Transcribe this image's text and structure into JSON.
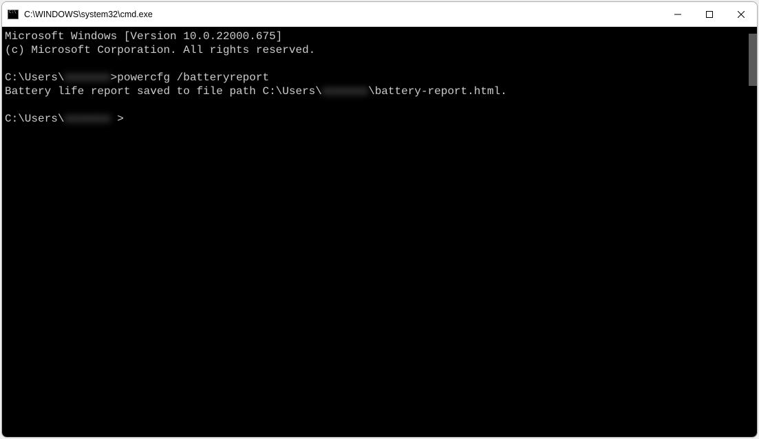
{
  "window": {
    "title": "C:\\WINDOWS\\system32\\cmd.exe"
  },
  "terminal": {
    "header_line1": "Microsoft Windows [Version 10.0.22000.675]",
    "header_line2": "(c) Microsoft Corporation. All rights reserved.",
    "prompt1_prefix": "C:\\Users\\",
    "prompt1_user_redacted": "xxxxxxx",
    "prompt1_sep": ">",
    "prompt1_command": "powercfg /batteryreport",
    "output_prefix": "Battery life report saved to file path C:\\Users\\",
    "output_user_redacted": "xxxxxxx",
    "output_suffix": "\\battery-report.html.",
    "prompt2_prefix": "C:\\Users\\",
    "prompt2_user_redacted": "xxxxxxx",
    "prompt2_sep": ">"
  }
}
